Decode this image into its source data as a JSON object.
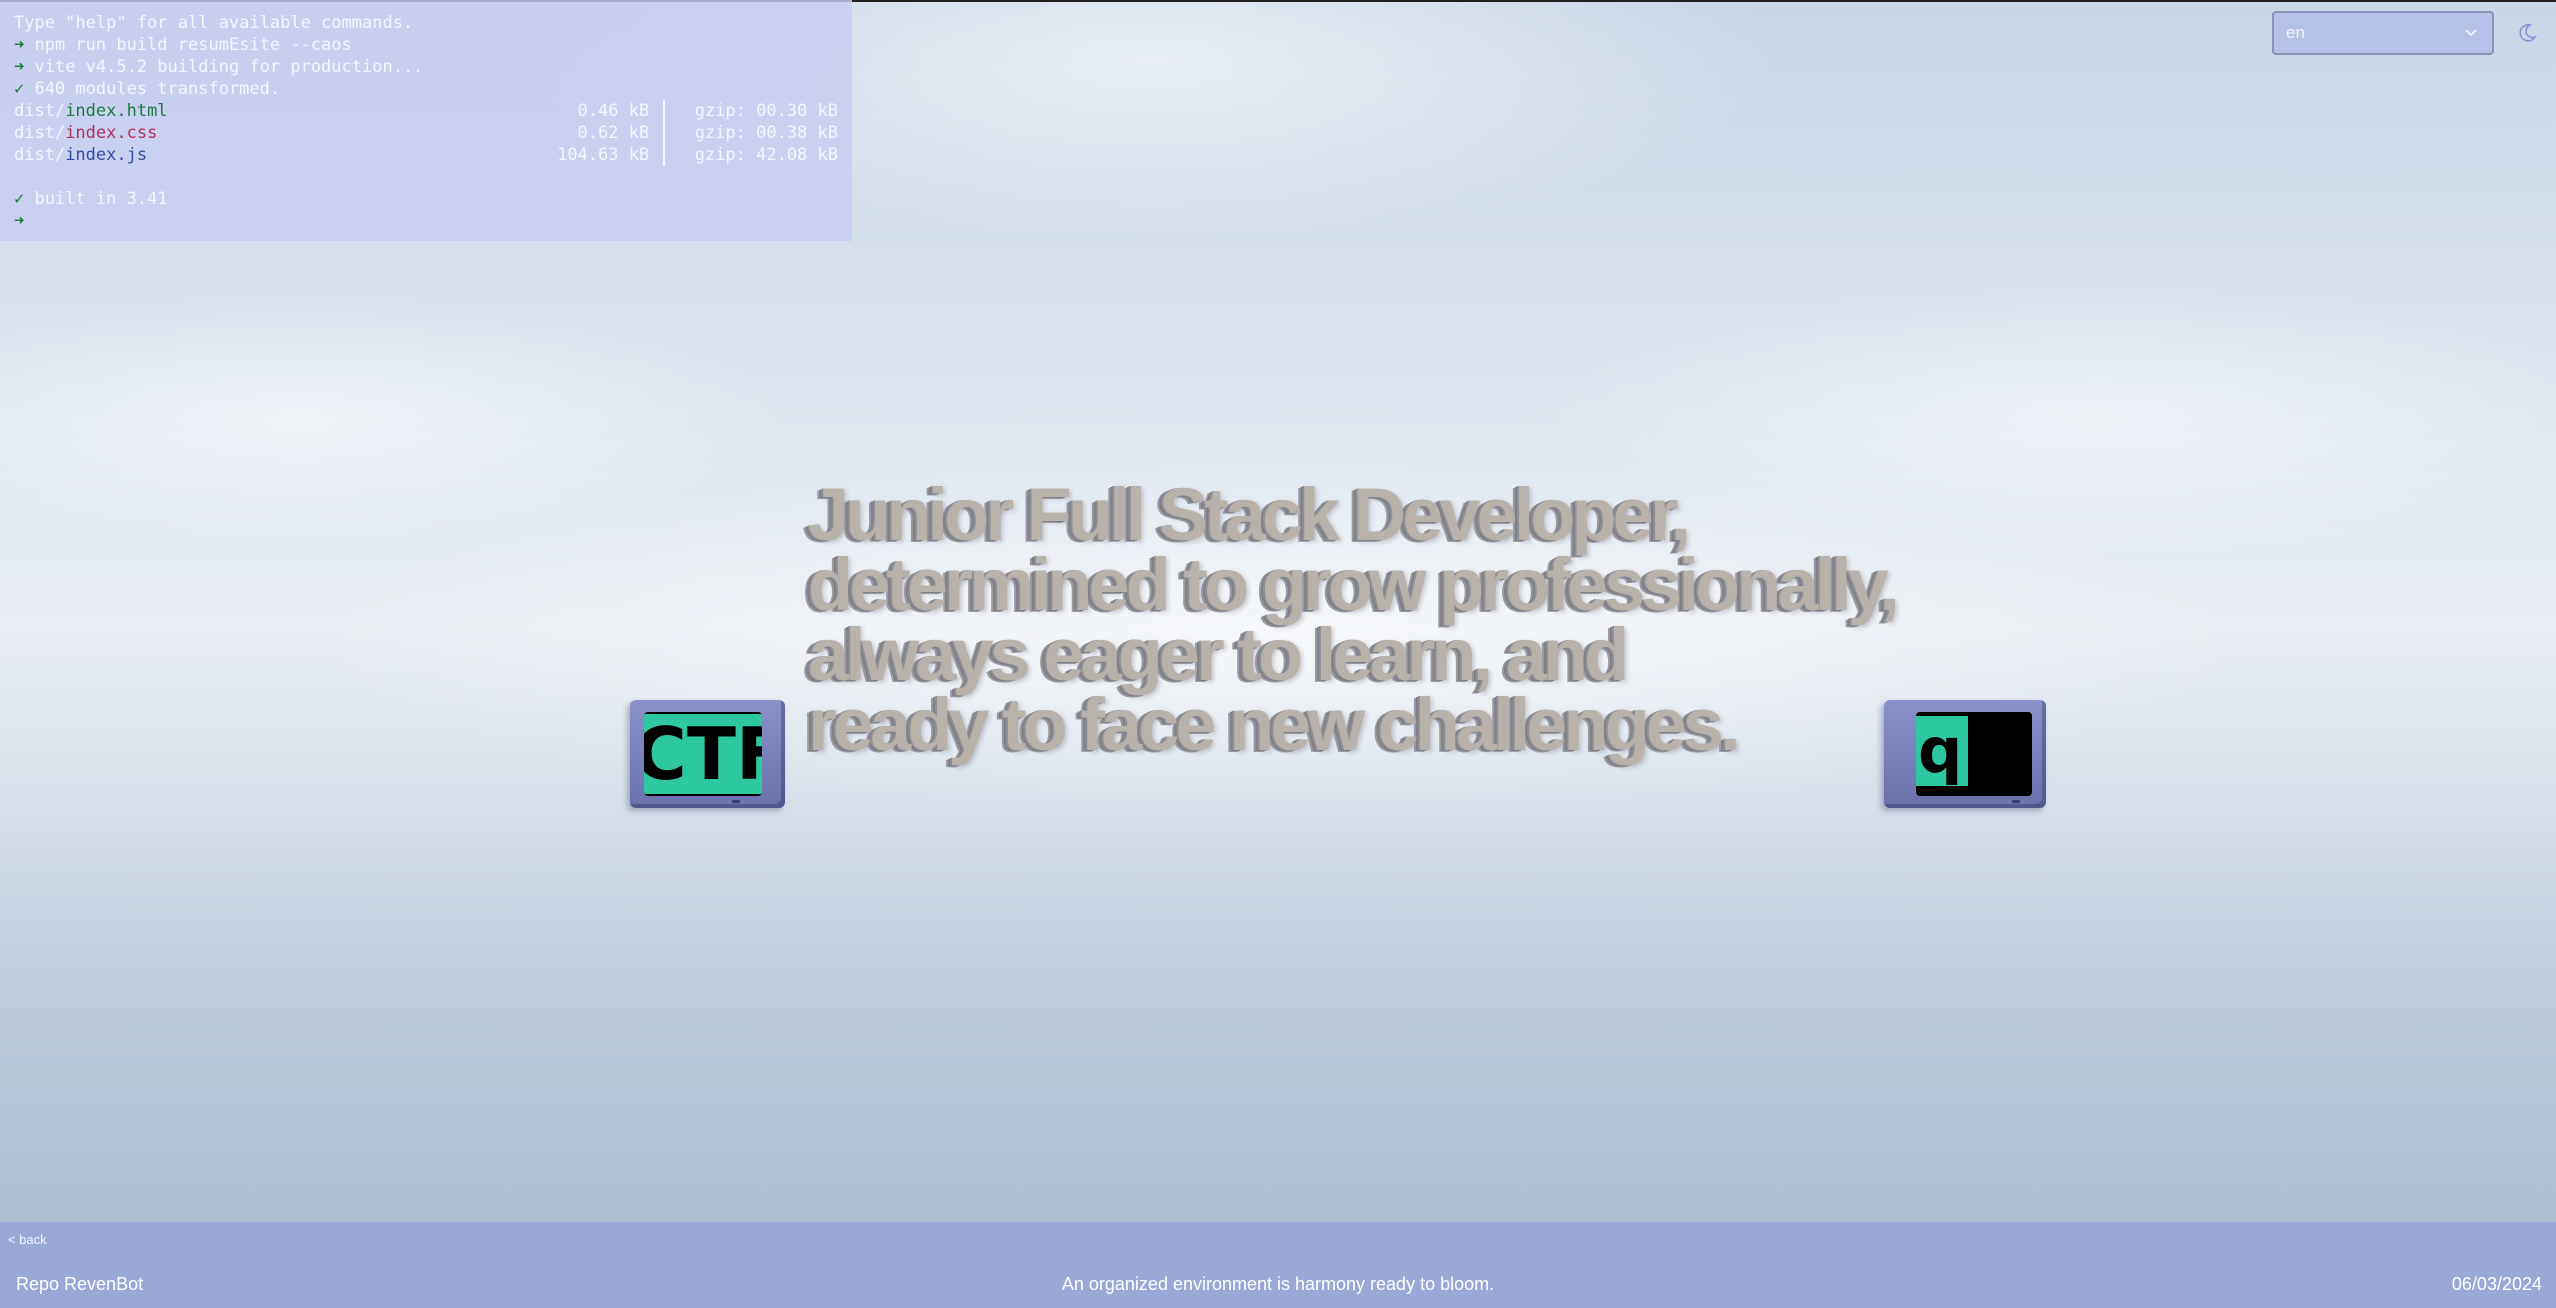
{
  "terminal": {
    "line1": "Type \"help\" for all available commands.",
    "prompt_symbol": "➜",
    "check_symbol": "✓",
    "cmd1": " npm run build resumEsite --caos",
    "cmd2": " vite v4.5.2 building for production...",
    "modules": " 640 modules transformed.",
    "files": [
      {
        "dir": "dist/",
        "name": "index.html",
        "size": "0.46 kB",
        "gzip": "gzip: 00.30 kB"
      },
      {
        "dir": "dist/",
        "name": "index.css",
        "size": "0.62 kB",
        "gzip": "gzip: 00.38 kB"
      },
      {
        "dir": "dist/",
        "name": "index.js",
        "size": "104.63 kB",
        "gzip": "gzip: 42.08 kB"
      }
    ],
    "built": " built in 3.41"
  },
  "language": {
    "selected": "en"
  },
  "theme": {
    "icon": "moon-icon"
  },
  "headline": {
    "lines": [
      "Junior Full Stack Developer,",
      "determined to grow professionally,",
      "always eager to learn, and",
      "ready to face new challenges."
    ]
  },
  "monitors": {
    "left_screen": "CTF",
    "right_screen": "q"
  },
  "footer": {
    "back": "< back",
    "left": "Repo RevenBot",
    "center": "An organized environment is harmony ready to bloom.",
    "date": "06/03/2024"
  },
  "colors": {
    "terminal_bg": "#c8cdf0",
    "footer_bg": "#96a5d7",
    "prompt_green": "#1e7a3e",
    "monitor_screen_text": "#2ec8a0"
  }
}
